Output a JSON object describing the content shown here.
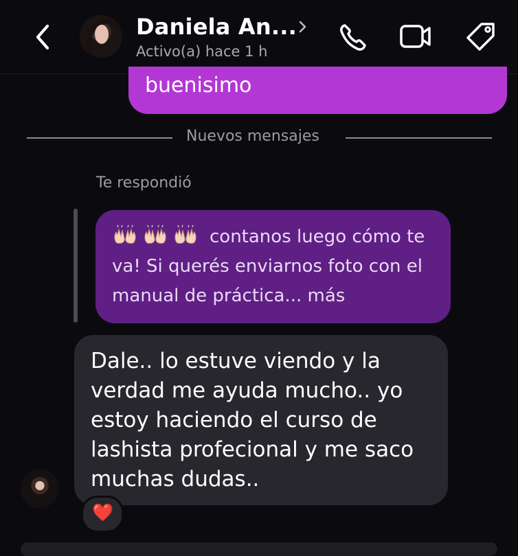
{
  "header": {
    "contact_name": "Daniela An...",
    "status": "Activo(a) hace 1 h"
  },
  "messages": {
    "sent_last": "buenisimo",
    "divider": "Nuevos mensajes",
    "reply_label": "Te respondió",
    "quoted": {
      "emojis": "🙌🙌🙌",
      "text": "contanos luego cómo te va! Si querés enviarnos foto con el manual de práctica... más"
    },
    "incoming": "Dale.. lo estuve viendo y la verdad me ayuda mucho.. yo estoy haciendo el curso de lashista profecional y me saco muchas dudas..",
    "reaction": "❤️"
  },
  "icons": {
    "back": "chevron-left-icon",
    "call": "phone-icon",
    "video": "video-camera-icon",
    "tag": "tag-icon"
  },
  "colors": {
    "background": "#0b0b0f",
    "sent_bubble": "#b337d5",
    "quoted_bubble": "#5f1f84",
    "incoming_bubble": "#27272d",
    "reaction": "#ff2f4f"
  }
}
